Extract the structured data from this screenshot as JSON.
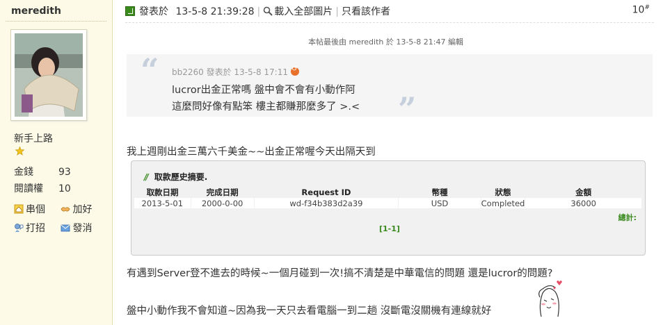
{
  "author": {
    "name": "meredith",
    "rank": "新手上路",
    "stats": [
      {
        "label": "金錢",
        "value": "93"
      },
      {
        "label": "閱讀權",
        "value": "10"
      }
    ],
    "actions": [
      {
        "label": "串個",
        "icon": "home-icon"
      },
      {
        "label": "加好",
        "icon": "handshake-icon"
      },
      {
        "label": "打招",
        "icon": "greet-icon"
      },
      {
        "label": "發消",
        "icon": "envelope-icon"
      }
    ]
  },
  "post": {
    "posted_prefix": "發表於",
    "posted_time": "13-5-8 21:39:28",
    "load_images": "載入全部圖片",
    "only_author": "只看該作者",
    "floor": "10",
    "floor_sup": "#",
    "edit_note": "本帖最後由 meredith 於 13-5-8 21:47 編輯"
  },
  "quote": {
    "meta": "bb2260 發表於 13-5-8 17:11",
    "line1": "lucror出金正常嗎 盤中會不會有小動作阿",
    "line2": "這麼問好像有點笨 樓主都賺那麼多了 >.<"
  },
  "body": {
    "p1": "我上週剛出金三萬六千美金~~出金正常喔今天出隔天到",
    "p2": "有遇到Server登不進去的時候~一個月碰到一次!搞不清楚是中華電信的問題 還是lucror的問題?",
    "p3": "盤中小動作我不會知道~因為我一天只去看電腦一到二趟 沒斷電沒關機有連線就好"
  },
  "withdrawal": {
    "title": "取款歷史摘要.",
    "columns": [
      "取款日期",
      "完成日期",
      "Request ID",
      "幣種",
      "狀態",
      "金額"
    ],
    "rows": [
      [
        "2013-5-01",
        "2000-0-00",
        "wd-f34b383d2a39",
        "USD",
        "Completed",
        "36000"
      ]
    ],
    "total_label": "總計:",
    "pager": "[1-1]"
  },
  "colors": {
    "sidebar_bg": "#fdfbe8",
    "accent_green": "#3a8a1e",
    "quote_bg": "#f5f5f5"
  }
}
